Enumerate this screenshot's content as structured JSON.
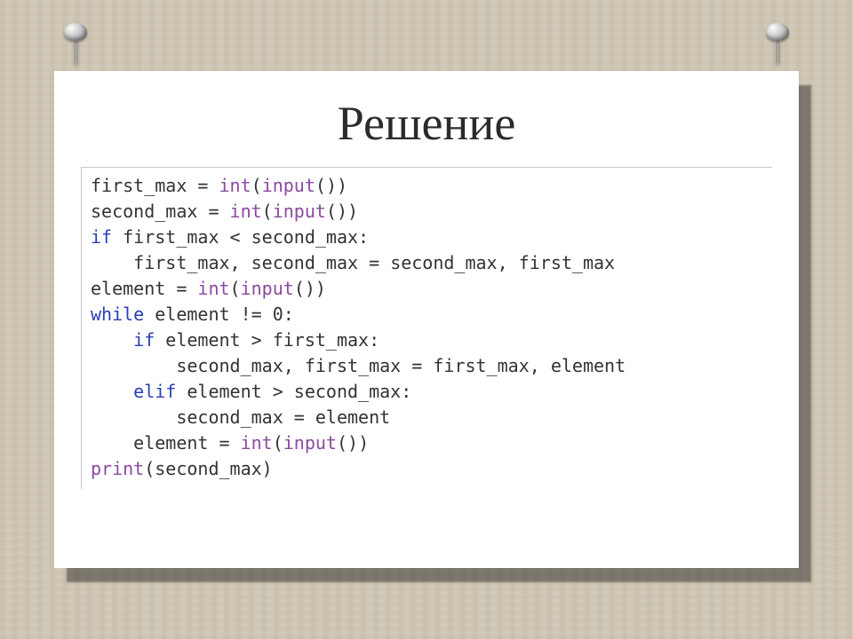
{
  "title": "Решение",
  "code": {
    "l1_a": "first_max ",
    "l1_b": "= ",
    "l1_c": "int",
    "l1_d": "(",
    "l1_e": "input",
    "l1_f": "())",
    "l2_a": "second_max ",
    "l2_b": "= ",
    "l2_c": "int",
    "l2_d": "(",
    "l2_e": "input",
    "l2_f": "())",
    "l3_a": "if",
    "l3_b": " first_max ",
    "l3_c": "<",
    "l3_d": " second_max",
    "l3_e": ":",
    "l4_a": "    first_max",
    "l4_b": ", ",
    "l4_c": "second_max ",
    "l4_d": "= ",
    "l4_e": "second_max",
    "l4_f": ", ",
    "l4_g": "first_max",
    "l5_a": "element ",
    "l5_b": "= ",
    "l5_c": "int",
    "l5_d": "(",
    "l5_e": "input",
    "l5_f": "())",
    "l6_a": "while",
    "l6_b": " element ",
    "l6_c": "!=",
    "l6_d": " ",
    "l6_e": "0",
    "l6_f": ":",
    "l7_a": "    ",
    "l7_b": "if",
    "l7_c": " element ",
    "l7_d": ">",
    "l7_e": " first_max",
    "l7_f": ":",
    "l8_a": "        second_max",
    "l8_b": ", ",
    "l8_c": "first_max ",
    "l8_d": "= ",
    "l8_e": "first_max",
    "l8_f": ", ",
    "l8_g": "element",
    "l9_a": "    ",
    "l9_b": "elif",
    "l9_c": " element ",
    "l9_d": ">",
    "l9_e": " second_max",
    "l9_f": ":",
    "l10_a": "        second_max ",
    "l10_b": "= ",
    "l10_c": "element",
    "l11_a": "    element ",
    "l11_b": "= ",
    "l11_c": "int",
    "l11_d": "(",
    "l11_e": "input",
    "l11_f": "())",
    "l12_a": "print",
    "l12_b": "(second_max)"
  }
}
